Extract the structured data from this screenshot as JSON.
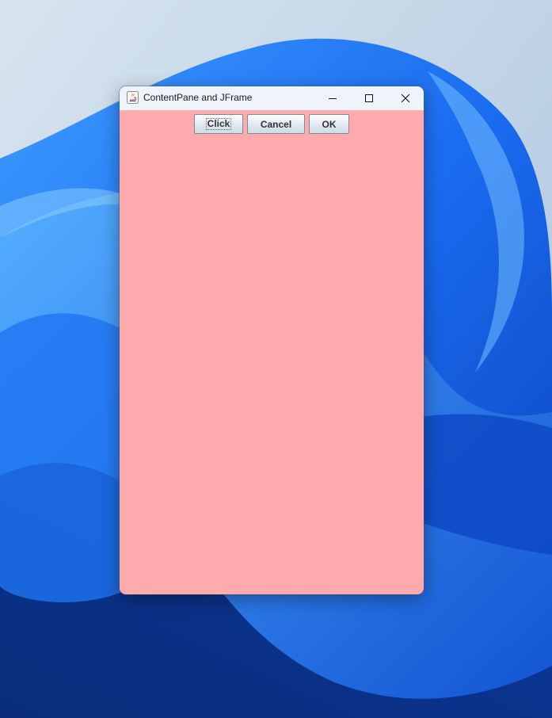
{
  "window": {
    "title": "ContentPane and JFrame",
    "content_background": "#ffaaad"
  },
  "title_controls": {
    "minimize": "minimize-icon",
    "maximize": "maximize-icon",
    "close": "close-icon"
  },
  "buttons": {
    "click_label": "Click",
    "cancel_label": "Cancel",
    "ok_label": "OK"
  }
}
